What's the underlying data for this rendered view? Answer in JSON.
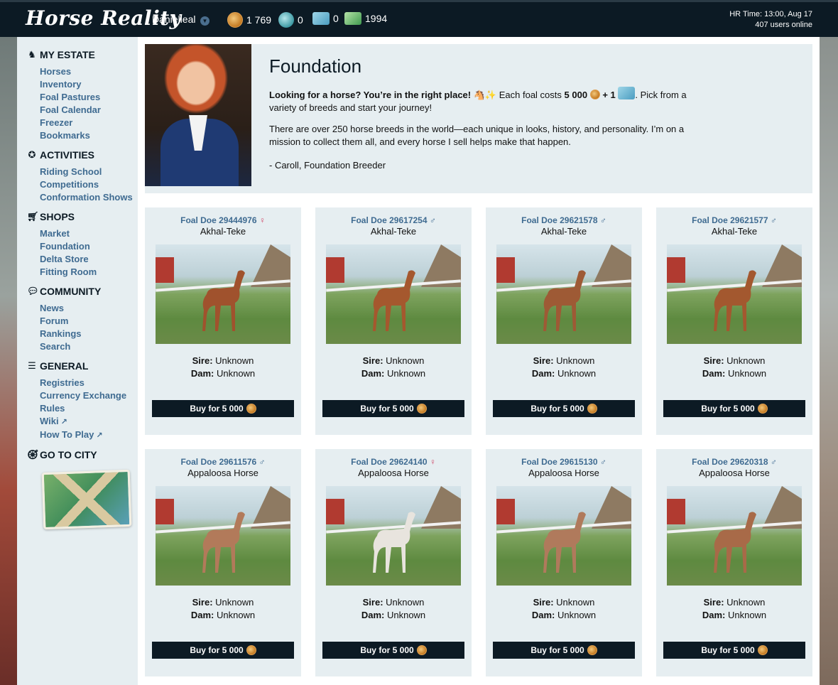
{
  "header": {
    "logo": "Horse Reality",
    "username": "Danielleal",
    "currencies": [
      {
        "icon": "horseshoe-coin-icon",
        "value": "1 769"
      },
      {
        "icon": "pass-token-icon",
        "value": "0"
      },
      {
        "icon": "ticket-icon",
        "value": "0"
      },
      {
        "icon": "banknote-icon",
        "value": "1994"
      }
    ],
    "hr_time": "HR Time: 13:00, Aug 17",
    "users_online": "407 users online"
  },
  "sidebar": {
    "sections": [
      {
        "title": "MY ESTATE",
        "icon": "horse-head-icon",
        "items": [
          "Horses",
          "Inventory",
          "Foal Pastures",
          "Foal Calendar",
          "Freezer",
          "Bookmarks"
        ]
      },
      {
        "title": "ACTIVITIES",
        "icon": "ribbon-icon",
        "items": [
          "Riding School",
          "Competitions",
          "Conformation Shows"
        ]
      },
      {
        "title": "SHOPS",
        "icon": "cart-icon",
        "items": [
          "Market",
          "Foundation",
          "Delta Store",
          "Fitting Room"
        ]
      },
      {
        "title": "COMMUNITY",
        "icon": "chat-icon",
        "items": [
          "News",
          "Forum",
          "Rankings",
          "Search"
        ]
      },
      {
        "title": "GENERAL",
        "icon": "list-icon",
        "items": [
          "Registries",
          "Currency Exchange",
          "Rules",
          "Wiki",
          "How To Play"
        ]
      }
    ],
    "go_to_city": "GO TO CITY"
  },
  "intro": {
    "title": "Foundation",
    "lead_bold": "Looking for a horse? You’re in the right place!",
    "lead_rest_1": "Each foal costs",
    "cost": "5 000",
    "plus": "+ 1",
    "lead_rest_2": ". Pick from a variety of breeds and start your journey!",
    "paragraph2": "There are over 250 horse breeds in the world—each unique in looks, history, and personality. I’m on a mission to collect them all, and every horse I sell helps make that happen.",
    "signature": "- Caroll, Foundation Breeder"
  },
  "labels": {
    "sire": "Sire:",
    "dam": "Dam:",
    "buy": "Buy for 5 000"
  },
  "horses": [
    {
      "name": "Foal Doe 29444976",
      "sex": "♀",
      "breed": "Akhal-Teke",
      "sire": "Unknown",
      "dam": "Unknown",
      "coat": "#a0522d"
    },
    {
      "name": "Foal Doe 29617254",
      "sex": "♂",
      "breed": "Akhal-Teke",
      "sire": "Unknown",
      "dam": "Unknown",
      "coat": "#a5582e"
    },
    {
      "name": "Foal Doe 29621578",
      "sex": "♂",
      "breed": "Akhal-Teke",
      "sire": "Unknown",
      "dam": "Unknown",
      "coat": "#9e5a35"
    },
    {
      "name": "Foal Doe 29621577",
      "sex": "♂",
      "breed": "Akhal-Teke",
      "sire": "Unknown",
      "dam": "Unknown",
      "coat": "#a3582f"
    },
    {
      "name": "Foal Doe 29611576",
      "sex": "♂",
      "breed": "Appaloosa Horse",
      "sire": "Unknown",
      "dam": "Unknown",
      "coat": "#b27a5a"
    },
    {
      "name": "Foal Doe 29624140",
      "sex": "♀",
      "breed": "Appaloosa Horse",
      "sire": "Unknown",
      "dam": "Unknown",
      "coat": "#e8e4de"
    },
    {
      "name": "Foal Doe 29615130",
      "sex": "♂",
      "breed": "Appaloosa Horse",
      "sire": "Unknown",
      "dam": "Unknown",
      "coat": "#b07a5c"
    },
    {
      "name": "Foal Doe 29620318",
      "sex": "♂",
      "breed": "Appaloosa Horse",
      "sire": "Unknown",
      "dam": "Unknown",
      "coat": "#a86a48"
    }
  ]
}
